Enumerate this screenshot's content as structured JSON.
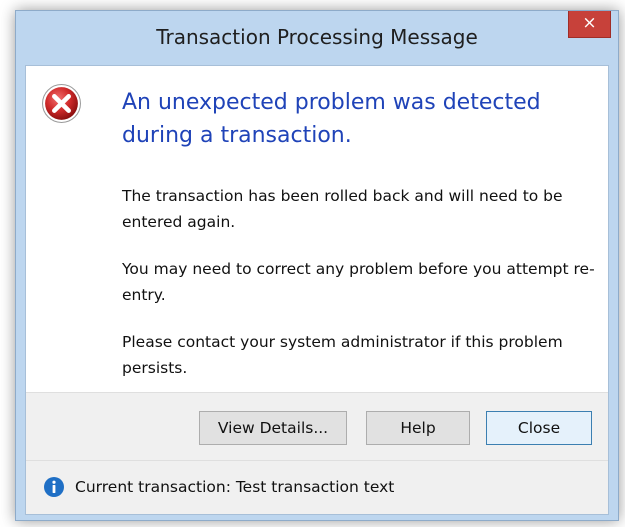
{
  "window": {
    "title": "Transaction Processing Message",
    "close_glyph": "×"
  },
  "icons": {
    "main": "error-icon",
    "footer": "info-icon",
    "colors": {
      "error_red": "#d12b2b",
      "info_blue": "#1f6fc5"
    }
  },
  "message": {
    "main_instruction": "An unexpected problem was detected during a transaction.",
    "paragraphs": [
      "The transaction has been rolled back and will need to be entered again.",
      "You may need to correct any problem before you attempt re-entry.",
      "Please contact your system administrator if this problem persists."
    ]
  },
  "buttons": {
    "view_details": "View Details...",
    "help": "Help",
    "close": "Close"
  },
  "footer": {
    "text": "Current transaction: Test transaction text"
  },
  "colors": {
    "titlebar": "#bdd6ef",
    "close_button": "#c7413a",
    "instruction_text": "#1f43b8"
  }
}
